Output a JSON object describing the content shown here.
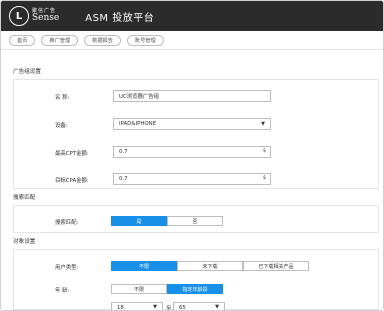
{
  "brand": {
    "logo_cn": "聚信广告",
    "logo_en": "Sense",
    "logo_glyph": "L"
  },
  "app_title": "ASM 投放平台",
  "nav_tabs": [
    "首页",
    "推广管理",
    "数据报告",
    "账号管理"
  ],
  "sections": {
    "ad_group": "广告组设置",
    "search_match": "搜索匹配",
    "audience": "对象设置"
  },
  "form": {
    "name_label": "名 称:",
    "name_value": "UC浏览器广告组",
    "device_label": "设备:",
    "device_value": "IPAD&IPHONE",
    "max_cpt_label": "最高CPT金额:",
    "max_cpt_value": "0.7",
    "max_cpt_suffix": "$",
    "target_cpa_label": "目标CPA金额:",
    "target_cpa_value": "0.7",
    "target_cpa_suffix": "$"
  },
  "search_match": {
    "label": "搜索匹配:",
    "options": [
      "是",
      "否"
    ],
    "selected": "是"
  },
  "audience": {
    "user_type_label": "用户类型:",
    "user_type_options": [
      "不限",
      "未下载",
      "已下载相关产品"
    ],
    "user_type_selected": "不限",
    "age_label": "年 龄:",
    "age_options": [
      "不限",
      "指定年龄段"
    ],
    "age_selected": "指定年龄段",
    "age_min": "18",
    "age_max": "65",
    "age_to": "至"
  },
  "colors": {
    "topbar": "#2b2b2b",
    "accent": "#1890e8"
  },
  "icons": {
    "select": "caret-down-icon"
  }
}
